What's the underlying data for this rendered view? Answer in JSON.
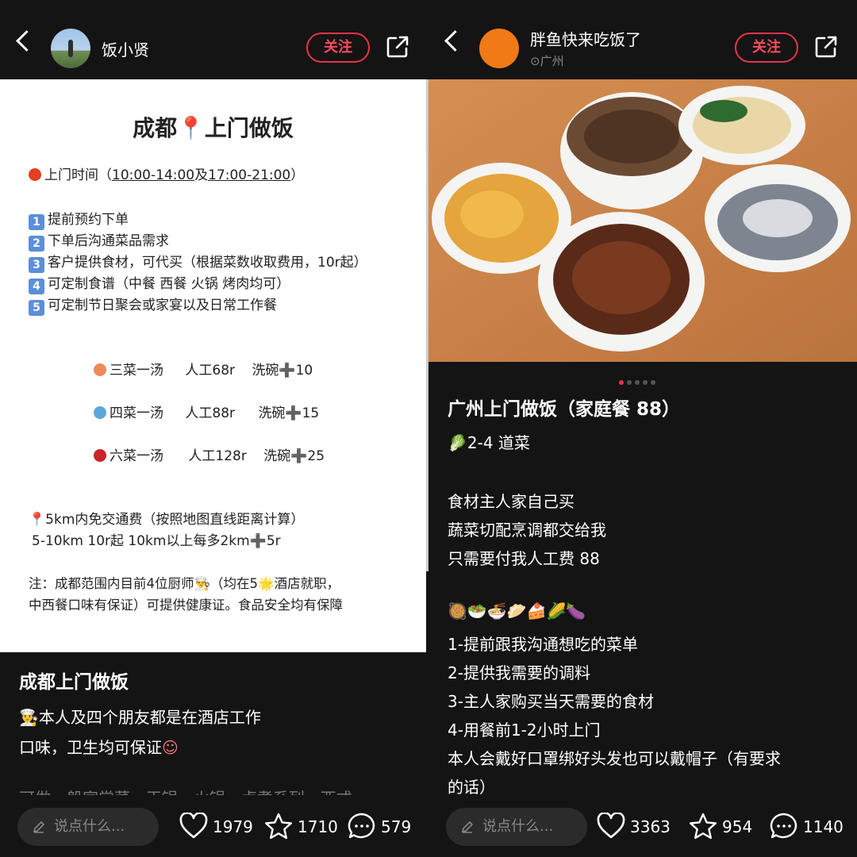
{
  "left": {
    "header": {
      "username": "饭小贤",
      "follow_label": "关注"
    },
    "poster": {
      "title": "成都📍上门做饭",
      "hours_prefix": "上门时间（",
      "hours_a": "10:00-14:00",
      "hours_mid": "及",
      "hours_b": "17:00-21:00",
      "hours_suffix": "）",
      "steps": [
        "提前预约下单",
        "下单后沟通菜品需求",
        "客户提供食材，可代买（根据菜数收取费用，10r起）",
        "可定制食谱（中餐 西餐 火锅 烤肉均可）",
        "可定制节日聚会或家宴以及日常工作餐"
      ],
      "packages": [
        {
          "name": "三菜一汤",
          "labor": "人工68r",
          "wash": "洗碗➕10"
        },
        {
          "name": "四菜一汤",
          "labor": "人工88r",
          "wash": "洗碗➕15"
        },
        {
          "name": "六菜一汤",
          "labor": "人工128r",
          "wash": "洗碗➕25"
        }
      ],
      "travel_1": "5km内免交通费（按照地图直线距离计算）",
      "travel_2": "5-10km 10r起  10km以上每多2km➕5r",
      "note_1": "注：成都范围内目前4位厨师👨‍🍳（均在5🌟酒店就职，",
      "note_2": "中西餐口味有保证）可提供健康证。食品安全均有保障"
    },
    "caption": {
      "title": "成都上门做饭",
      "line1": "本人及四个朋友都是在酒店工作",
      "line2": "口味，卫生均可保证",
      "line3": "可做一般家常菜 - 干锅 - 火锅 - 卤煮系列 - 西式"
    },
    "bottom": {
      "placeholder": "说点什么...",
      "likes": "1979",
      "stars": "1710",
      "comments": "579"
    }
  },
  "right": {
    "header": {
      "username": "胖鱼快来吃饭了",
      "location": "广州",
      "follow_label": "关注"
    },
    "post": {
      "title": "广州上门做饭（家庭餐 88）",
      "dishes": "2-4 道菜",
      "para": [
        "食材主人家自己买",
        "蔬菜切配烹调都交给我",
        "只需要付我人工费 88"
      ],
      "emoji_row": "🥘🥗🍜🥟🍰🌽🍆",
      "steps": [
        "1-提前跟我沟通想吃的菜单",
        "2-提供我需要的调料",
        "3-主人家购买当天需要的食材",
        "4-用餐前1-2小时上门",
        "本人会戴好口罩绑好头发也可以戴帽子（有要求",
        "的话）"
      ]
    },
    "carousel": {
      "count": 5,
      "active": 1
    },
    "bottom": {
      "placeholder": "说点什么...",
      "likes": "3363",
      "stars": "954",
      "comments": "1140"
    }
  },
  "colors": {
    "accent": "#e8324a",
    "background": "#141414"
  }
}
